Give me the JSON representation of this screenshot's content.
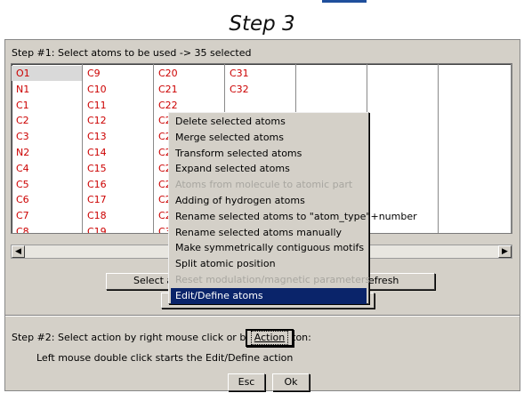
{
  "header": {
    "title": "Step 3"
  },
  "step1": {
    "label": "Step #1: Select atoms to be used  -> 35 selected"
  },
  "atom_columns": [
    [
      "O1",
      "N1",
      "C1",
      "C2",
      "C3",
      "N2",
      "C4",
      "C5",
      "C6",
      "C7",
      "C8"
    ],
    [
      "C9",
      "C10",
      "C11",
      "C12",
      "C13",
      "C14",
      "C15",
      "C16",
      "C17",
      "C18",
      "C19"
    ],
    [
      "C20",
      "C21",
      "C22",
      "C2",
      "C2",
      "C2",
      "C2",
      "C2",
      "C2",
      "C2",
      "C3"
    ],
    [
      "C31",
      "C32",
      "",
      "",
      "",
      "",
      "",
      "",
      "",
      "",
      ""
    ],
    [],
    [],
    []
  ],
  "scrollbar": {
    "left_arrow": "◀",
    "right_arrow": "▶"
  },
  "buttons": {
    "select_partial": "Select a",
    "refresh_partial": "efresh",
    "action": "Action",
    "esc": "Esc",
    "ok": "Ok"
  },
  "step2": {
    "label": "Step #2: Select action by right mouse click or by this button:",
    "hint": "Left mouse double click starts the Edit/Define action"
  },
  "context_menu": {
    "items": [
      {
        "label": "Delete selected atoms",
        "state": "normal"
      },
      {
        "label": "Merge selected atoms",
        "state": "normal"
      },
      {
        "label": "Transform selected atoms",
        "state": "normal"
      },
      {
        "label": "Expand selected atoms",
        "state": "normal"
      },
      {
        "label": "Atoms from molecule to atomic part",
        "state": "disabled"
      },
      {
        "label": "Adding of hydrogen atoms",
        "state": "normal"
      },
      {
        "label": "Rename selected atoms to \"atom_type\"+number",
        "state": "normal"
      },
      {
        "label": "Rename selected atoms manually",
        "state": "normal"
      },
      {
        "label": "Make symmetrically contiguous motifs",
        "state": "normal"
      },
      {
        "label": "Split atomic position",
        "state": "normal"
      },
      {
        "label": "Reset modulation/magnetic parameters",
        "state": "disabled"
      },
      {
        "label": "Edit/Define atoms",
        "state": "active"
      }
    ]
  },
  "colors": {
    "atom_text": "#cc0000",
    "menu_highlight": "#0a246a",
    "dialog_bg": "#d4d0c8"
  }
}
